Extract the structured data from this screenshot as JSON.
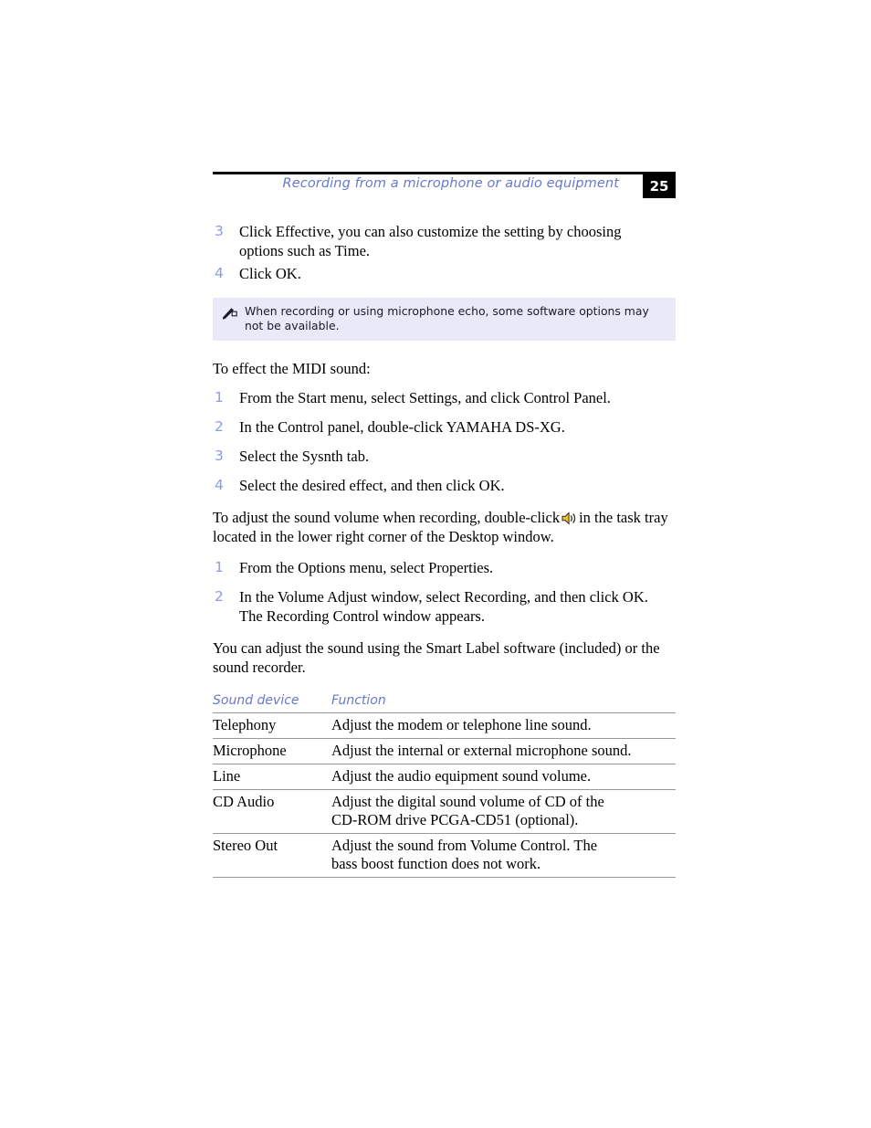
{
  "header": {
    "title": "Recording from a microphone or audio equipment",
    "page_number": "25",
    "accent_color": "#6778d0"
  },
  "steps_top": [
    {
      "num": "3",
      "text": "Click Effective, you can also customize the setting by choosing options such as Time."
    },
    {
      "num": "4",
      "text": "Click OK."
    }
  ],
  "note": {
    "icon": "note-pencil-icon",
    "text": "When recording or using microphone echo, some software options may not be available.",
    "background_color": "#e9e9f7"
  },
  "midi_section": {
    "lead": "To effect the MIDI sound:",
    "steps": [
      {
        "num": "1",
        "text": "From the Start menu, select Settings, and click Control Panel."
      },
      {
        "num": "2",
        "text": "In the Control panel, double-click YAMAHA DS-XG."
      },
      {
        "num": "3",
        "text": "Select the Sysnth tab."
      },
      {
        "num": "4",
        "text": "Select the desired effect, and then click OK."
      }
    ]
  },
  "volume_section": {
    "para_before_icon": "To adjust the sound volume when recording, double-click",
    "inline_icon": "speaker-volume-icon",
    "para_after_icon": "in the task tray located in the lower right corner of the Desktop window.",
    "steps": [
      {
        "num": "1",
        "text": "From the Options menu, select Properties."
      },
      {
        "num": "2",
        "text": "In the Volume Adjust window, select Recording, and then click OK. The Recording Control window appears."
      }
    ],
    "closing_para": "You can adjust the sound using the Smart Label software (included) or the sound recorder."
  },
  "table": {
    "headers": [
      "Sound device",
      "Function"
    ],
    "rows": [
      [
        "Telephony",
        "Adjust the modem or telephone line sound."
      ],
      [
        "Microphone",
        "Adjust the internal or external microphone sound."
      ],
      [
        "Line",
        "Adjust the audio equipment sound volume."
      ],
      [
        "CD Audio",
        "Adjust the digital sound volume of CD of the CD-ROM drive PCGA-CD51 (optional)."
      ],
      [
        "Stereo Out",
        "Adjust the sound from Volume Control. The bass boost function does not work."
      ]
    ]
  }
}
